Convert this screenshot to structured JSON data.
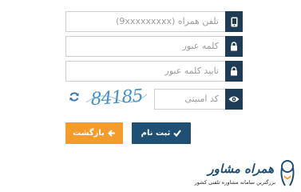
{
  "form": {
    "phone_placeholder": "تلفن همراه (9xxxxxxxxx)",
    "password_placeholder": "کلمه عبور",
    "confirm_password_placeholder": "تایید کلمه عبور",
    "captcha_placeholder": "کد امنیتی",
    "captcha_code": "84185"
  },
  "buttons": {
    "submit_label": "ثبت نام",
    "back_label": "بازگشت"
  },
  "brand": {
    "name": "همراه مشاور",
    "tagline": "بزرگترین سامانه مشاوره تلفنی کشور"
  },
  "colors": {
    "addon": "#1f3c57",
    "submit": "#1f4f73",
    "back": "#f39c2b",
    "captcha_text": "#4a90c8"
  },
  "icons": {
    "phone": "mobile-phone-icon",
    "password": "lock-icon",
    "confirm_password": "lock-icon",
    "captcha": "eye-icon",
    "refresh": "refresh-icon",
    "submit": "check-icon",
    "back": "arrow-left-icon"
  }
}
